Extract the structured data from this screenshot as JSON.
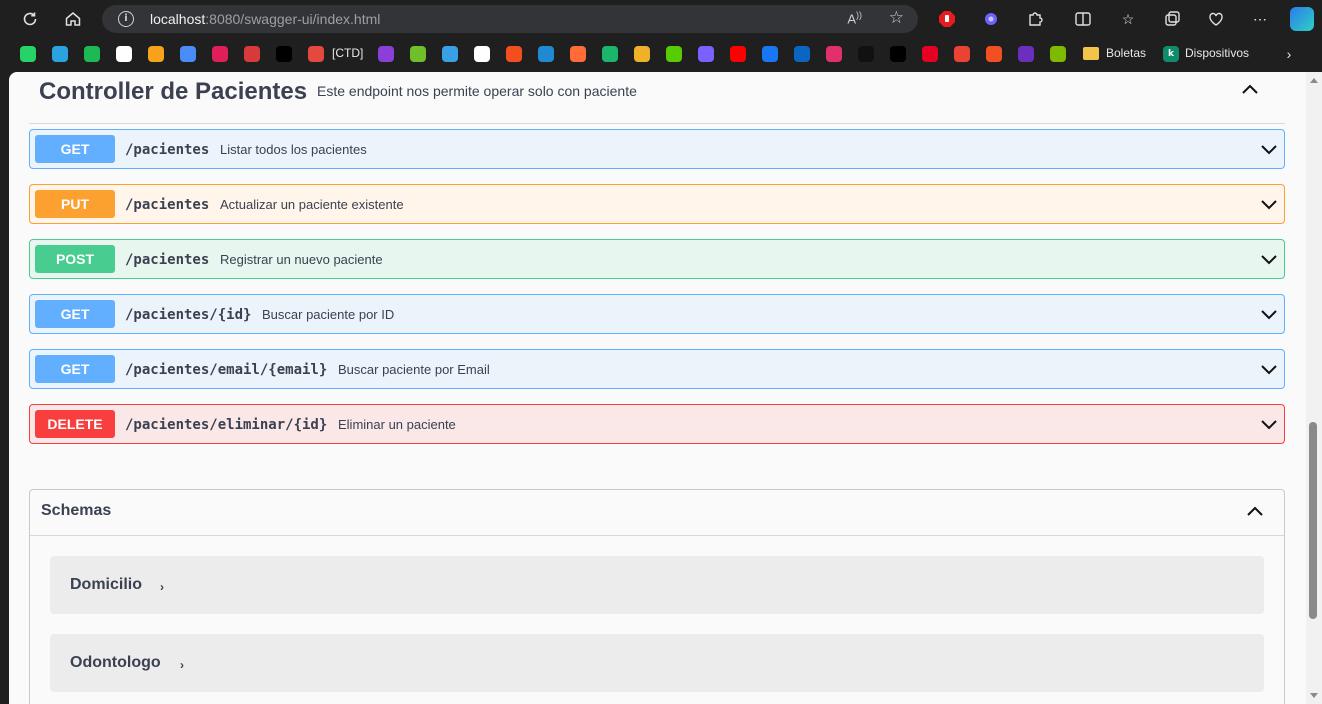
{
  "browser": {
    "url_host": "localhost",
    "url_rest": ":8080/swagger-ui/index.html",
    "read_aloud_icon": "Ȃ",
    "toolbar_icons": [
      "refresh-icon",
      "home-icon",
      "info-icon",
      "read-aloud-icon",
      "favorite-star-icon",
      "adblock-extension-icon",
      "extension-icon",
      "puzzle-extensions-icon",
      "split-screen-icon",
      "favorites-icon",
      "collections-icon",
      "browser-essentials-icon",
      "more-menu-icon",
      "copilot-icon"
    ]
  },
  "bookmarks": {
    "ctd_label": "[CTD]",
    "boletas_label": "Boletas",
    "dispositivos_label": "Dispositivos",
    "items": [
      {
        "name": "whatsapp-icon",
        "color": "#25d366",
        "glyph": ""
      },
      {
        "name": "telegram-icon",
        "color": "#2aa3df",
        "glyph": ""
      },
      {
        "name": "spotify-icon",
        "color": "#1db954",
        "glyph": ""
      },
      {
        "name": "chatgpt-icon",
        "color": "#ffffff",
        "glyph": ""
      },
      {
        "name": "m-bookmark-icon",
        "color": "#f7a21b",
        "glyph": ""
      },
      {
        "name": "gemini-icon",
        "color": "#4a8df8",
        "glyph": ""
      },
      {
        "name": "slack-icon",
        "color": "#e01e5a",
        "glyph": ""
      },
      {
        "name": "onek-plus-icon",
        "color": "#d83a3a",
        "glyph": ""
      },
      {
        "name": "dm-icon",
        "color": "#000000",
        "glyph": ""
      },
      {
        "name": "ctd-icon",
        "color": "#e5483f",
        "glyph": ""
      },
      {
        "name": "u-bookmark-icon",
        "color": "#8b3fd6",
        "glyph": ""
      },
      {
        "name": "diamond-icon",
        "color": "#6fbf2a",
        "glyph": ""
      },
      {
        "name": "window-icon",
        "color": "#3aa0e6",
        "glyph": ""
      },
      {
        "name": "github-icon",
        "color": "#ffffff",
        "glyph": ""
      },
      {
        "name": "figma-icon",
        "color": "#f24e1e",
        "glyph": ""
      },
      {
        "name": "vscode-icon",
        "color": "#1f8ad2",
        "glyph": ""
      },
      {
        "name": "postman-icon",
        "color": "#ff6c37",
        "glyph": ""
      },
      {
        "name": "leaf-icon",
        "color": "#1bb56c",
        "glyph": ""
      },
      {
        "name": "r-bookmark-icon",
        "color": "#f0b12a",
        "glyph": ""
      },
      {
        "name": "duolingo-icon",
        "color": "#58cc02",
        "glyph": ""
      },
      {
        "name": "s-bookmark-icon",
        "color": "#7b61ff",
        "glyph": ""
      },
      {
        "name": "youtube-icon",
        "color": "#ff0000",
        "glyph": ""
      },
      {
        "name": "facebook-icon",
        "color": "#1877f2",
        "glyph": ""
      },
      {
        "name": "linkedin-icon",
        "color": "#0a66c2",
        "glyph": ""
      },
      {
        "name": "instagram-icon",
        "color": "#e1306c",
        "glyph": ""
      },
      {
        "name": "tiktok-icon",
        "color": "#111111",
        "glyph": ""
      },
      {
        "name": "x-icon",
        "color": "#000000",
        "glyph": ""
      },
      {
        "name": "pinterest-icon",
        "color": "#e60023",
        "glyph": ""
      },
      {
        "name": "gmail-icon",
        "color": "#ea4335",
        "glyph": ""
      },
      {
        "name": "microsoft-icon",
        "color": "#f25022",
        "glyph": ""
      },
      {
        "name": "mail-icon",
        "color": "#6b2fbf",
        "glyph": ""
      },
      {
        "name": "microsoft-2-icon",
        "color": "#7fba00",
        "glyph": ""
      }
    ]
  },
  "section": {
    "title": "Controller de Pacientes",
    "description": "Este endpoint nos permite operar solo con paciente"
  },
  "operations": [
    {
      "method": "GET",
      "path": "/pacientes",
      "summary": "Listar todos los pacientes",
      "kind": "get"
    },
    {
      "method": "PUT",
      "path": "/pacientes",
      "summary": "Actualizar un paciente existente",
      "kind": "put"
    },
    {
      "method": "POST",
      "path": "/pacientes",
      "summary": "Registrar un nuevo paciente",
      "kind": "post"
    },
    {
      "method": "GET",
      "path": "/pacientes/{id}",
      "summary": "Buscar paciente por ID",
      "kind": "get"
    },
    {
      "method": "GET",
      "path": "/pacientes/email/{email}",
      "summary": "Buscar paciente por Email",
      "kind": "get"
    },
    {
      "method": "DELETE",
      "path": "/pacientes/eliminar/{id}",
      "summary": "Eliminar un paciente",
      "kind": "delete"
    }
  ],
  "schemas": {
    "title": "Schemas",
    "models": [
      {
        "name": "Domicilio",
        "arrow": "›"
      },
      {
        "name": "Odontologo",
        "arrow": "›"
      }
    ]
  },
  "colors": {
    "get": "#61affe",
    "put": "#fca130",
    "post": "#49cc90",
    "delete": "#f93e3e",
    "text": "#3b4151"
  }
}
